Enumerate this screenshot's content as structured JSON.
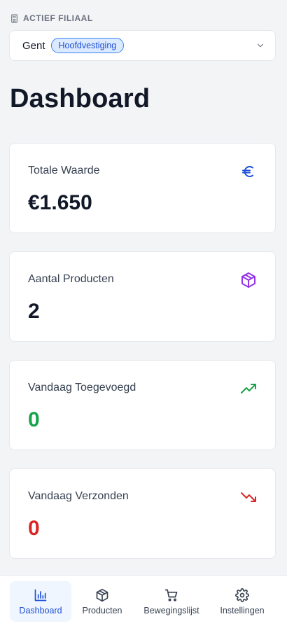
{
  "branch": {
    "label": "ACTIEF FILIAAL",
    "selected_name": "Gent",
    "badge": "Hoofdvestiging"
  },
  "page_title": "Dashboard",
  "stats": [
    {
      "label": "Totale Waarde",
      "value": "€1.650",
      "icon": "euro-icon",
      "color": "#1d4ed8"
    },
    {
      "label": "Aantal Producten",
      "value": "2",
      "icon": "package-icon",
      "color": "#9333ea"
    },
    {
      "label": "Vandaag Toegevoegd",
      "value": "0",
      "icon": "trending-up-icon",
      "color": "#16a34a"
    },
    {
      "label": "Vandaag Verzonden",
      "value": "0",
      "icon": "trending-down-icon",
      "color": "#dc2626"
    }
  ],
  "nav": {
    "items": [
      {
        "label": "Dashboard",
        "icon": "bar-chart-icon",
        "active": true
      },
      {
        "label": "Producten",
        "icon": "package-icon",
        "active": false
      },
      {
        "label": "Bewegingslijst",
        "icon": "cart-icon",
        "active": false
      },
      {
        "label": "Instellingen",
        "icon": "gear-icon",
        "active": false
      }
    ]
  }
}
